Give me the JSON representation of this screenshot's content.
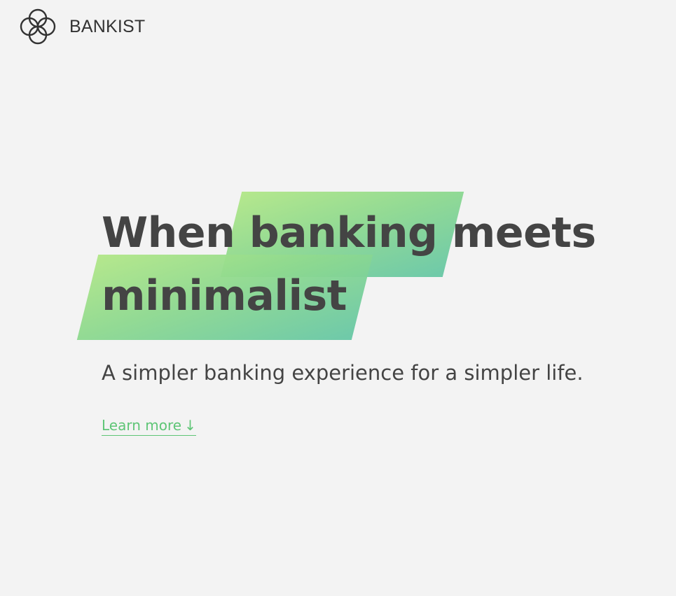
{
  "brand": {
    "name": "BANKIST",
    "icon": "logo-icon"
  },
  "hero": {
    "headline_word_1": "When",
    "headline_highlight_1": "banking",
    "headline_word_2": "meets",
    "headline_highlight_2": "minimalist",
    "subtitle": "A simpler banking experience for a simpler life.",
    "cta_label": "Learn more",
    "cta_arrow": "↓"
  },
  "colors": {
    "background": "#f3f3f3",
    "text": "#444444",
    "accent": "#5ec576",
    "highlight_start": "#b2e787",
    "highlight_end": "#67c7a6"
  }
}
